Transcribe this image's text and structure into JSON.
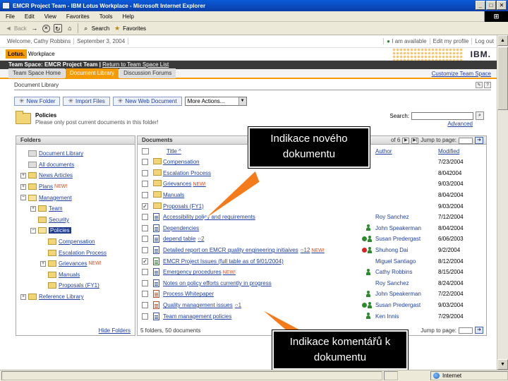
{
  "window": {
    "title": "EMCR Project Team - IBM Lotus Workplace - Microsoft Internet Explorer",
    "controls": [
      "_",
      "□",
      "✕"
    ]
  },
  "menu": [
    "File",
    "Edit",
    "View",
    "Favorites",
    "Tools",
    "Help"
  ],
  "toolbar": {
    "back": "Back",
    "search": "Search",
    "favorites": "Favorites"
  },
  "topbar": {
    "welcome": "Welcome, Cathy Robbins",
    "date": "September 3, 2004",
    "links": [
      "I am available",
      "Edit my profile",
      "Log out"
    ]
  },
  "brand": {
    "lotus": "Lotus.",
    "product": "Workplace",
    "ibm": "IBM."
  },
  "team_space": {
    "label": "Team Space: EMCR Project Team",
    "return_link": "Return to Team Space List",
    "tabs": [
      "Team Space Home",
      "Document Library",
      "Discussion Forums"
    ],
    "active_tab": "Document Library",
    "customize": "Customize Team Space"
  },
  "library": {
    "section_title": "Document Library",
    "actions": [
      "New Folder",
      "Import Files",
      "New Web Document"
    ],
    "more_actions": "More Actions...",
    "folder_title": "Policies",
    "folder_subtitle": "Please only post current documents in this folder!",
    "search_label": "Search:",
    "advanced": "Advanced"
  },
  "folders_panel": {
    "header": "Folders",
    "hide": "Hide Folders",
    "tree": [
      {
        "label": "Document Library",
        "indent": 0,
        "exp": "",
        "icon": "gray"
      },
      {
        "label": "All documents",
        "indent": 0,
        "exp": "",
        "icon": "gray"
      },
      {
        "label": "News Articles",
        "indent": 0,
        "exp": "+",
        "icon": "closed"
      },
      {
        "label": "Plans",
        "indent": 0,
        "exp": "+",
        "icon": "closed",
        "new": "NEW!"
      },
      {
        "label": "Management",
        "indent": 0,
        "exp": "−",
        "icon": "open"
      },
      {
        "label": "Team",
        "indent": 1,
        "exp": "+",
        "icon": "closed"
      },
      {
        "label": "Security",
        "indent": 1,
        "exp": "",
        "icon": "closed"
      },
      {
        "label": "Policies",
        "indent": 1,
        "exp": "−",
        "icon": "open",
        "selected": true
      },
      {
        "label": "Compensation",
        "indent": 2,
        "exp": "",
        "icon": "closed"
      },
      {
        "label": "Escalation Process",
        "indent": 2,
        "exp": "",
        "icon": "closed"
      },
      {
        "label": "Grievances",
        "indent": 2,
        "exp": "+",
        "icon": "closed",
        "new": "NEW!"
      },
      {
        "label": "Manuals",
        "indent": 2,
        "exp": "",
        "icon": "closed"
      },
      {
        "label": "Proposals (FY1)",
        "indent": 2,
        "exp": "",
        "icon": "closed"
      },
      {
        "label": "Reference Library",
        "indent": 0,
        "exp": "+",
        "icon": "closed"
      }
    ]
  },
  "documents_panel": {
    "header": "Documents",
    "pager_of": "of 6",
    "jump_label": "Jump to page:",
    "columns": {
      "title": "Title ^",
      "author": "Author",
      "modified": "Modified"
    },
    "footer": "5 folders, 50 documents",
    "rows": [
      {
        "title": "Compensation",
        "type": "folder",
        "author": "",
        "author_icon": "",
        "modified": "7/23/2004"
      },
      {
        "title": "Escalation Process",
        "type": "folder",
        "author": "",
        "author_icon": "",
        "modified": "8/042004"
      },
      {
        "title": "Grievances",
        "type": "folder",
        "new": "NEW!",
        "author": "",
        "author_icon": "",
        "modified": "9/03/2004"
      },
      {
        "title": "Manuals",
        "type": "folder",
        "author": "",
        "author_icon": "",
        "modified": "8/04/2004"
      },
      {
        "title": "Proposals (FY1)",
        "type": "folder",
        "checked": true,
        "author": "",
        "author_icon": "",
        "modified": "9/03/2004"
      },
      {
        "title": "Accessibility policy and requirements",
        "type": "doc",
        "author": "Roy Sanchez",
        "author_icon": "",
        "modified": "7/12/2004"
      },
      {
        "title": "Dependencies",
        "type": "doc",
        "author": "John Speakerman",
        "author_icon": "person",
        "modified": "8/04/2004"
      },
      {
        "title": "depend table",
        "type": "doc",
        "comments": "2",
        "author": "Susan Predergast",
        "author_icon": "status-green",
        "modified": "6/06/2003"
      },
      {
        "title": "Detailed report on EMCR quality engineering initiaives",
        "type": "doc",
        "comments": "12",
        "new": "NEW!",
        "author": "Shuhong Dai",
        "author_icon": "status-red",
        "modified": "9/2/2004"
      },
      {
        "title": "EMCR Project Issues (full table as of 9/01/2004)",
        "type": "xls",
        "checked": true,
        "author": "Miguel Santiago",
        "author_icon": "",
        "modified": "8/12/2004"
      },
      {
        "title": "Emergency procedures",
        "type": "doc",
        "new": "NEW!",
        "author": "Cathy Robbins",
        "author_icon": "person",
        "modified": "8/15/2004"
      },
      {
        "title": "Notes on policy efforts currently in progress",
        "type": "doc",
        "author": "Roy Sanchez",
        "author_icon": "",
        "modified": "8/24/2004"
      },
      {
        "title": "Process Whitepaper",
        "type": "ppt",
        "author": "John Speakerman",
        "author_icon": "person",
        "modified": "7/22/2004"
      },
      {
        "title": "Quality management issues",
        "type": "ppt",
        "comments": "1",
        "author": "Susan Predergast",
        "author_icon": "status-green",
        "modified": "9/03/2004"
      },
      {
        "title": "Team management policies",
        "type": "doc",
        "author": "Ken Innis",
        "author_icon": "person",
        "modified": "7/29/2004"
      }
    ]
  },
  "callouts": {
    "new_doc": "Indikace nového dokumentu",
    "comments": "Indikace komentářů k dokumentu"
  },
  "statusbar": {
    "zone": "Internet"
  },
  "colors": {
    "accent": "#f59b00",
    "link": "#1f3fa6",
    "new_tag": "#e04a1a",
    "titlebar": "#0b5bd8"
  }
}
